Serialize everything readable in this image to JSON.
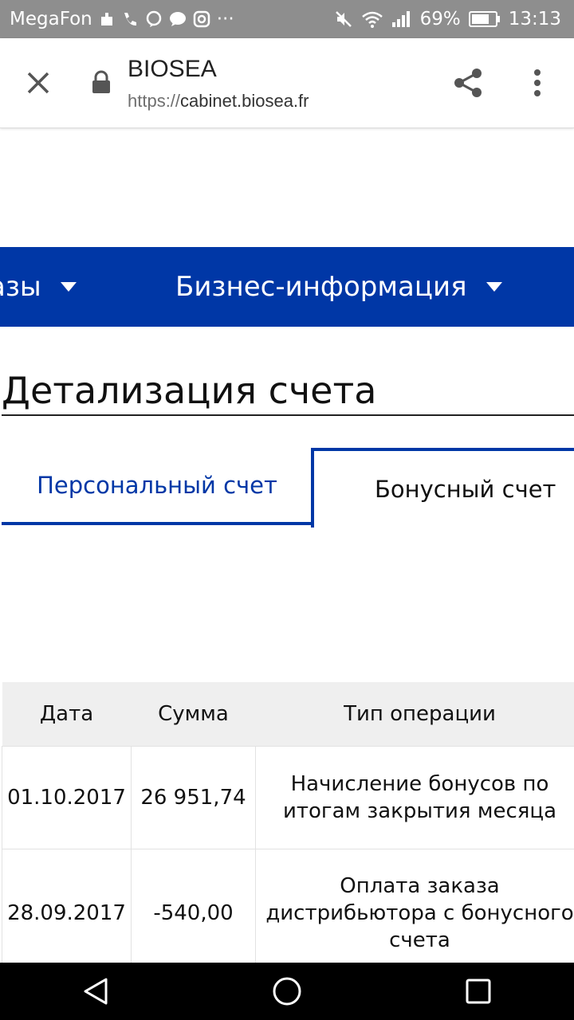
{
  "status_bar": {
    "carrier": "MegaFon",
    "extra": "···",
    "battery": "69%",
    "time": "13:13"
  },
  "browser": {
    "site_title": "BIOSEA",
    "url_scheme": "https://",
    "url_host": "cabinet.biosea.fr"
  },
  "nav": {
    "items": [
      {
        "label": "азы"
      },
      {
        "label": "Бизнес-информация"
      }
    ]
  },
  "page": {
    "title": "Детализация счета"
  },
  "tabs": [
    {
      "label": "Персональный счет",
      "active": false
    },
    {
      "label": "Бонусный счет",
      "active": true
    }
  ],
  "table": {
    "headers": [
      "Дата",
      "Сумма",
      "Тип операции"
    ],
    "rows": [
      {
        "date": "01.10.2017",
        "sum": "26 951,74",
        "type": "Начисление бонусов по итогам закрытия месяца"
      },
      {
        "date": "28.09.2017",
        "sum": "-540,00",
        "type": "Оплата заказа дистрибьютора с бонусного счета"
      }
    ]
  },
  "colors": {
    "brand_blue": "#0037a6",
    "status_bar": "#8e8e8e",
    "table_header": "#efefef"
  },
  "icons": {
    "status": [
      "sim-icon",
      "phone-icon",
      "viber-icon",
      "message-icon",
      "instagram-icon",
      "mute-icon",
      "wifi-icon",
      "signal-icon",
      "battery-icon"
    ],
    "browser": [
      "close-icon",
      "lock-icon",
      "share-icon",
      "more-vert-icon"
    ],
    "system_nav": [
      "back-icon",
      "home-icon",
      "recents-icon"
    ]
  }
}
